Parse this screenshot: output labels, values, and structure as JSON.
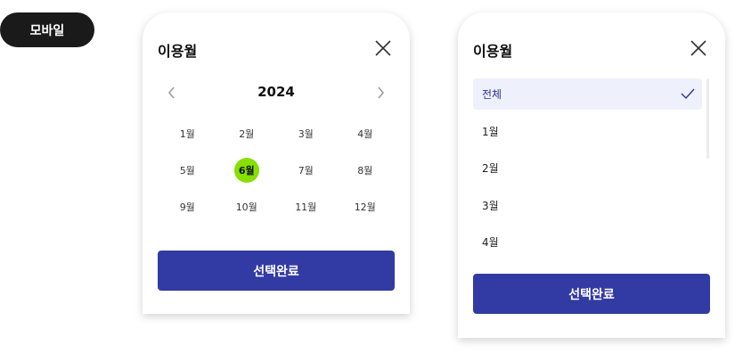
{
  "badge": {
    "label": "모바일"
  },
  "calendar_panel": {
    "title": "이용월",
    "year": "2024",
    "months": [
      "1월",
      "2월",
      "3월",
      "4월",
      "5월",
      "6월",
      "7월",
      "8월",
      "9월",
      "10월",
      "11월",
      "12월"
    ],
    "selected_month": "6월",
    "confirm_label": "선택완료",
    "accent": "#86e000"
  },
  "list_panel": {
    "title": "이용월",
    "items": [
      "전체",
      "1월",
      "2월",
      "3월",
      "4월"
    ],
    "selected_item": "전체",
    "confirm_label": "선택완료"
  },
  "colors": {
    "button": "#323aa3",
    "selected_bg": "#eef0fb"
  }
}
